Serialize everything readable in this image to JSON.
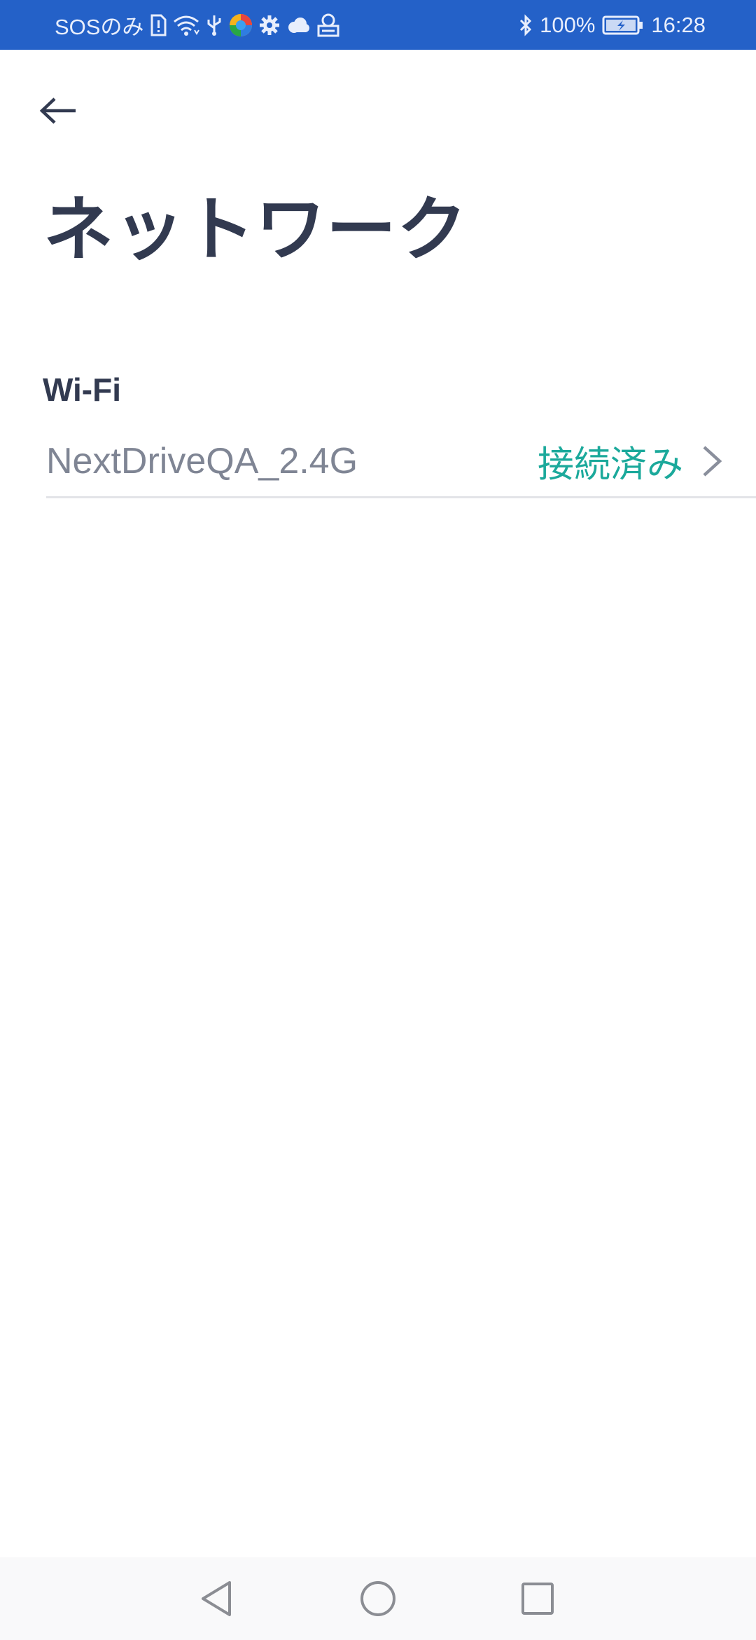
{
  "status_bar": {
    "carrier": "SOSのみ",
    "battery": "100%",
    "time": "16:28",
    "icons_left": [
      "sim-alert-icon",
      "wifi-icon",
      "usb-icon",
      "browser-app-icon",
      "settings-icon",
      "cloud-icon",
      "notification-app-icon"
    ],
    "icons_right": [
      "bluetooth-icon",
      "battery-charging-icon"
    ],
    "background_color": "#2461c8"
  },
  "header": {
    "back_icon": "arrow-left-icon",
    "title": "ネットワーク"
  },
  "wifi_section": {
    "label": "Wi-Fi",
    "network_name": "NextDriveQA_2.4G",
    "status": "接続済み",
    "status_color": "#1ba99b",
    "chevron_icon": "chevron-right-icon"
  },
  "nav_bar": {
    "back_icon": "triangle-back-icon",
    "home_icon": "circle-home-icon",
    "recents_icon": "square-recents-icon"
  }
}
